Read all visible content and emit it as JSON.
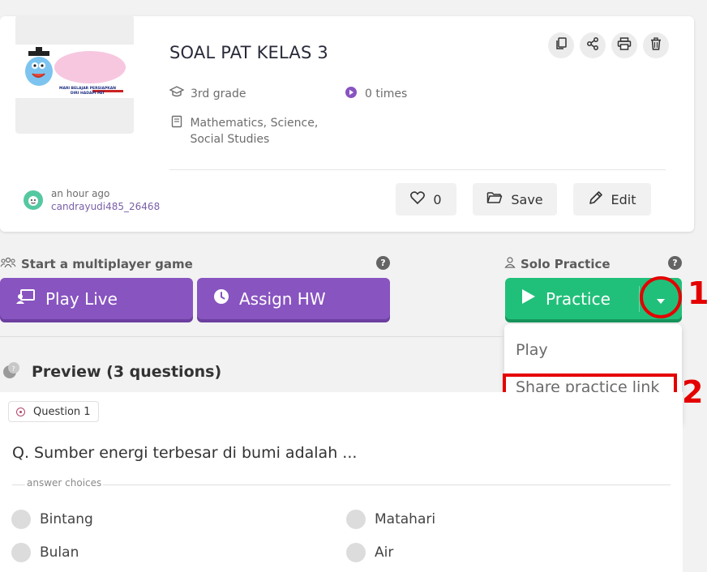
{
  "quiz": {
    "title": "SOAL PAT KELAS 3",
    "thumbnail_text": "MARI BELAJAR PERSIAPKAN DIRI HADAPI PAT",
    "grade": "3rd grade",
    "times": "0 times",
    "subjects": "Mathematics, Science, Social Studies",
    "author_time": "an hour ago",
    "author_name": "candrayudi485_26468",
    "like_count": "0",
    "save_label": "Save",
    "edit_label": "Edit",
    "top_actions": [
      "copy-icon",
      "share-icon",
      "print-icon",
      "trash-icon"
    ]
  },
  "game": {
    "multiplayer_label": "Start a multiplayer game",
    "play_live_label": "Play Live",
    "assign_hw_label": "Assign HW",
    "solo_label": "Solo Practice",
    "practice_label": "Practice",
    "help_glyph": "?"
  },
  "dropdown": {
    "items": [
      "Play",
      "Share practice link"
    ]
  },
  "annotations": {
    "mark_1": "1",
    "mark_2": "2",
    "color": "#e50000"
  },
  "preview": {
    "title": "Preview (3 questions)",
    "question_chip": "Question 1",
    "question_text": "Q. Sumber energi terbesar di bumi adalah ...",
    "answer_label": "answer choices",
    "choices": [
      "Bintang",
      "Matahari",
      "Bulan",
      "Air"
    ]
  },
  "colors": {
    "purple": "#8854c0",
    "green": "#21c07a"
  }
}
